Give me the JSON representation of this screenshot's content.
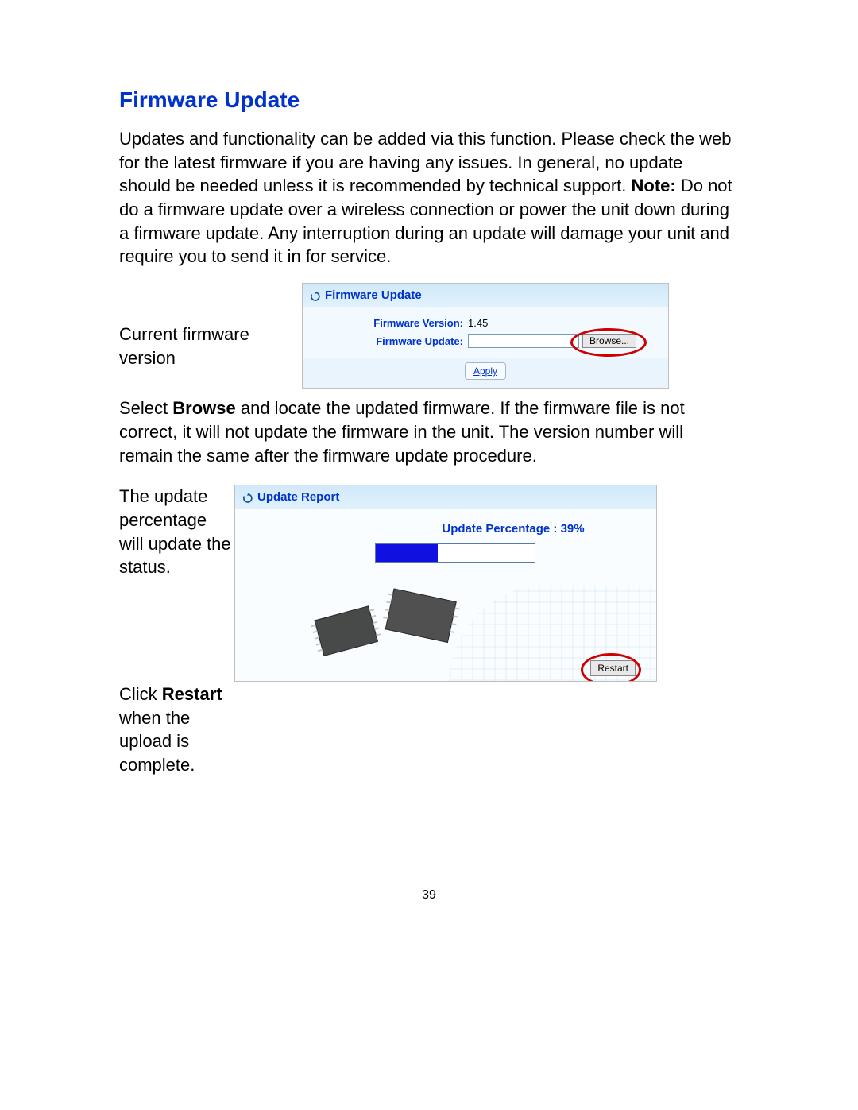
{
  "heading": "Firmware Update",
  "intro": {
    "text_pre_note": "Updates and functionality can be added via this function. Please check the web for the latest firmware if you are having any issues. In general, no update should be needed unless it is recommended by technical support. ",
    "note_label": "Note:",
    "text_post_note": " Do not do a firmware update over a wireless connection or power the unit down during a firmware update. Any interruption during an update will damage your unit and require you to send it in for service."
  },
  "caption_current": "Current firmware version",
  "panel1": {
    "title": "Firmware Update",
    "version_label": "Firmware Version:",
    "version_value": "1.45",
    "update_label": "Firmware Update:",
    "browse_label": "Browse...",
    "apply_label": "Apply"
  },
  "paragraph2": {
    "pre_bold": "Select ",
    "bold": "Browse",
    "post_bold": " and locate the updated firmware. If the firmware file is not correct, it will not update the firmware in the unit. The version number will remain the same after the firmware update procedure."
  },
  "caption_percentage": "The update percentage will update the status.",
  "caption_restart": {
    "pre_bold": "Click ",
    "bold": "Restart",
    "post_bold": " when the upload is complete."
  },
  "panel2": {
    "title": "Update Report",
    "percentage_label": "Update Percentage : 39%",
    "progress_percent": 39,
    "restart_label": "Restart"
  },
  "page_number": "39"
}
